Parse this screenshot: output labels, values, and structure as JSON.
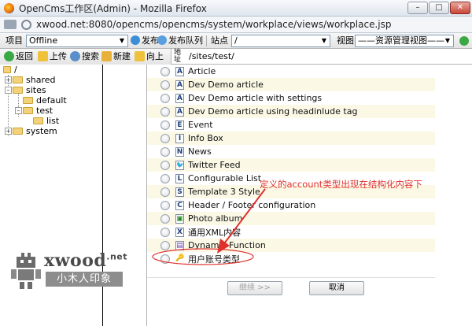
{
  "window": {
    "title": "OpenCms工作区(Admin) - Mozilla Firefox",
    "buttons": [
      "–",
      "□",
      "✕"
    ]
  },
  "address": {
    "url": "xwood.net:8080/opencms/opencms/system/workplace/views/workplace.jsp"
  },
  "toolbar1": {
    "project_label": "项目",
    "project_value": "Offline",
    "publish_label": "发布",
    "publish_queue_label": "发布队列",
    "site_label": "站点",
    "site_value": "/",
    "view_label": "视图",
    "view_value": "——资源管理视图——"
  },
  "toolbar2": {
    "back": "返回",
    "upload": "上传",
    "search": "搜索",
    "new": "新建",
    "up": "向上",
    "address_label": "地址",
    "path": "/sites/test/"
  },
  "tree": {
    "root": "/",
    "items": [
      {
        "label": "shared"
      },
      {
        "label": "sites"
      },
      {
        "label": "default"
      },
      {
        "label": "test"
      },
      {
        "label": "list"
      },
      {
        "label": "system"
      }
    ]
  },
  "dialog": {
    "options": [
      {
        "icon": "A",
        "label": "Article"
      },
      {
        "icon": "A",
        "label": "Dev Demo article"
      },
      {
        "icon": "A",
        "label": "Dev Demo article with settings"
      },
      {
        "icon": "A",
        "label": "Dev Demo article using headinlude tag"
      },
      {
        "icon": "E",
        "label": "Event"
      },
      {
        "icon": "I",
        "label": "Info Box"
      },
      {
        "icon": "N",
        "label": "News"
      },
      {
        "icon": "🐦",
        "label": "Twitter Feed"
      },
      {
        "icon": "L",
        "label": "Configurable List"
      },
      {
        "icon": "S",
        "label": "Template 3 Style"
      },
      {
        "icon": "C",
        "label": "Header / Footer configuration"
      },
      {
        "icon": "▣",
        "label": "Photo album"
      },
      {
        "icon": "X",
        "label": "通用XML内容"
      },
      {
        "icon": "▤",
        "label": "Dynamic Function"
      },
      {
        "icon": "🔑",
        "label": "用户账号类型"
      }
    ],
    "continue_button": "继续 >>",
    "cancel_button": "取消"
  },
  "annotation": {
    "text": "定义的account类型出现在结构化内容下",
    "color": "#e0312c"
  },
  "watermark": {
    "name": "xwood",
    "suffix": ".net",
    "subtitle": "小木人印象"
  }
}
